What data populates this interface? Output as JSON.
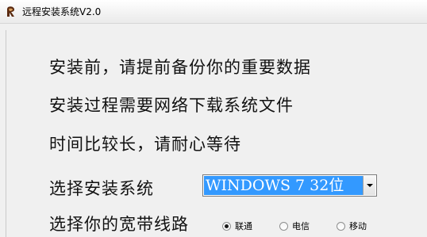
{
  "window": {
    "title": "远程安装系统V2.0",
    "icon": "app-logo-icon"
  },
  "messages": [
    "安装前，请提前备份你的重要数据",
    "安装过程需要网络下载系统文件",
    "时间比较长，请耐心等待"
  ],
  "system_select": {
    "label": "选择安装系统",
    "value": "WINDOWS 7 32位"
  },
  "broadband": {
    "label": "选择你的宽带线路",
    "options": [
      "联通",
      "电信",
      "移动"
    ],
    "selected": "联通"
  },
  "colors": {
    "selection": "#3399ff",
    "background": "#f0f0f0"
  }
}
